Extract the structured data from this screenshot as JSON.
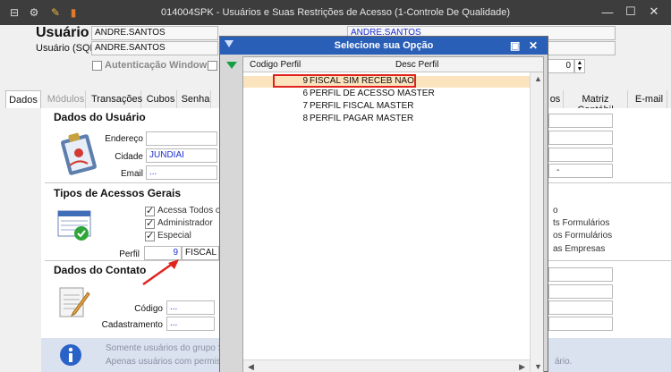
{
  "window": {
    "title": "014004SPK - Usuários e Suas Restrições de Acesso (1-Controle De Qualidade)",
    "titlebar_icons": [
      "window-icon",
      "refresh-icon",
      "tools-icon",
      "book-icon"
    ],
    "minimize": "—",
    "maximize": "☐",
    "close": "✕"
  },
  "header": {
    "usuario_label": "Usuário",
    "usuario_value": "ANDRE.SANTOS",
    "usuario_value_right": "ANDRE.SANTOS",
    "sql_label": "Usuário (SQL):",
    "sql_value": "ANDRE.SANTOS",
    "auth_label": "Autenticação Windows",
    "spinner_value": "0"
  },
  "tabs": [
    {
      "label": "Dados"
    },
    {
      "label": "Módulos"
    },
    {
      "label": "Transações"
    },
    {
      "label": "Cubos"
    },
    {
      "label": "Senha"
    },
    {
      "label": "os"
    },
    {
      "label": "Matriz Contábil"
    },
    {
      "label": "E-mail"
    }
  ],
  "dados_usuario": {
    "title": "Dados do Usuário",
    "endereco_label": "Endereço",
    "cidade_label": "Cidade",
    "cidade_value": "JUNDIAI",
    "email_label": "Email",
    "email_value": "...",
    "right_value": "-"
  },
  "acessos": {
    "title": "Tipos de Acessos Gerais",
    "acessa_todos": "Acessa Todos o",
    "administrador": "Administrador",
    "especial": "Especial",
    "perfil_label": "Perfil",
    "perfil_code": "9",
    "perfil_desc": "FISCAL S",
    "right_items": [
      "o",
      "ts Formulários",
      "os Formulários",
      "as Empresas"
    ]
  },
  "contato": {
    "title": "Dados do Contato",
    "codigo_label": "Código",
    "codigo_value": "...",
    "cadastramento_label": "Cadastramento",
    "cadastramento_value": "..."
  },
  "info": {
    "line1": "Somente usuários do grupo Sy",
    "line2": "Apenas usuários com permiss",
    "line2_right": "ário."
  },
  "modal": {
    "title": "Selecione sua Opção",
    "col_code": "Codigo Perfil",
    "col_desc": "Desc Perfil",
    "rows": [
      {
        "code": "9",
        "desc": "FISCAL SIM RECEB NAO"
      },
      {
        "code": "6",
        "desc": "PERFIL DE ACESSO MASTER"
      },
      {
        "code": "7",
        "desc": "PERFIL FISCAL MASTER"
      },
      {
        "code": "8",
        "desc": "PERFIL PAGAR MASTER"
      }
    ],
    "colors": {
      "titlebar": "#2a5fb8",
      "selected_row": "#fbe3bd",
      "highlight": "#e0231d"
    }
  }
}
